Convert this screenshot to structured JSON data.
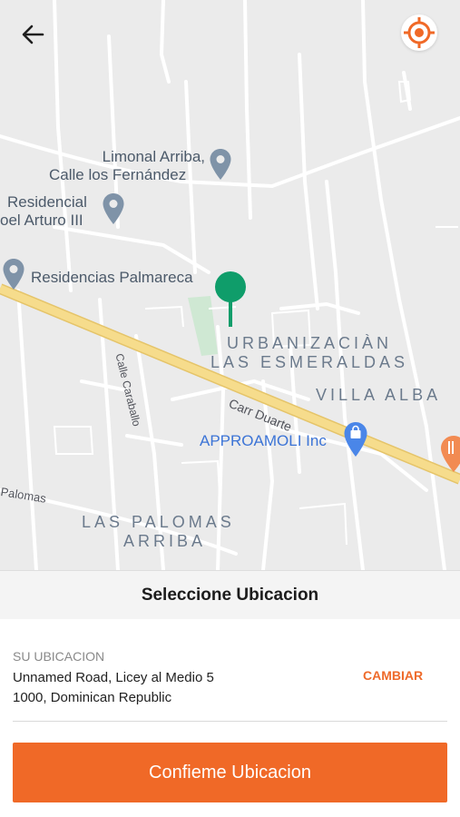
{
  "map": {
    "poi_limonal_line1": "Limonal Arriba,",
    "poi_limonal_line2": "Calle los Fernández",
    "poi_residencial_line1": "Residencial",
    "poi_residencial_line2": "oel Arturo III",
    "poi_palmareca": "Residencias Palmareca",
    "poi_approamoli": "APPROAMOLI Inc",
    "area_urbanizacion_line1": "URBANIZACIÀN",
    "area_urbanizacion_line2": "LAS ESMERALDAS",
    "area_villa_alba": "VILLA ALBA",
    "area_las_palomas_line1": "LAS PALOMAS",
    "area_las_palomas_line2": "ARRIBA",
    "street_carr_duarte": "Carr Duarte",
    "street_calle_caraballo": "Calle Caraballo",
    "street_palomas": "Palomas",
    "icons": {
      "back": "arrow-left-icon",
      "locate": "crosshair-icon",
      "pin": "map-pin-icon",
      "poi": "place-pin-icon",
      "shop": "shopping-bag-icon",
      "restaurant": "fork-knife-icon"
    }
  },
  "sheet": {
    "title": "Seleccione Ubicacion",
    "location_label": "SU UBICACION",
    "address": "Unnamed Road, Licey al Medio 5 1000, Dominican Republic",
    "change_label": "CAMBIAR",
    "confirm_label": "Confieme Ubicacion"
  },
  "colors": {
    "accent": "#f06927",
    "pin": "#0f9d6a",
    "highway": "#f6dc8c",
    "map_bg": "#ebebeb"
  }
}
